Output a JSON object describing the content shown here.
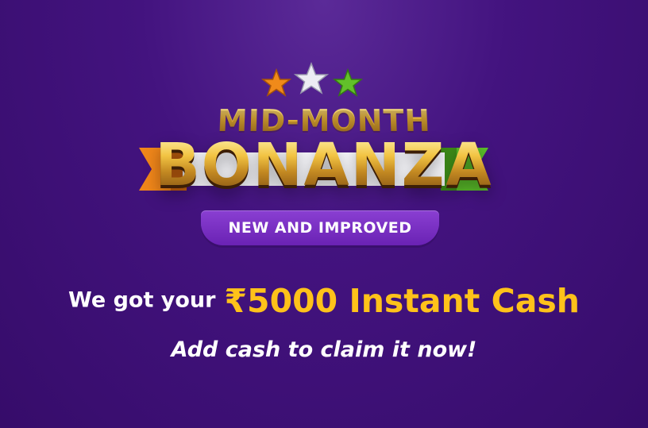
{
  "banner": {
    "title_top": "MID-MONTH",
    "title_main": "BONANZA",
    "tag": "NEW AND IMPROVED",
    "offer_prefix": "We got your",
    "offer_amount": "₹5000 Instant Cash",
    "cta": "Add cash to claim it now!"
  },
  "colors": {
    "background": "#43137f",
    "gold": "#f2c443",
    "offer_yellow": "#ffc21a",
    "pill_purple": "#7a2fc4",
    "star_orange": "#f08a1a",
    "star_silver": "#e6e6ee",
    "star_green": "#62c02a",
    "ribbon_orange": "#f0861a",
    "ribbon_green": "#5bbf2a"
  },
  "icons": {
    "stars": [
      "orange-star-icon",
      "silver-star-icon",
      "green-star-icon"
    ],
    "ribbon": "tricolor-ribbon-icon"
  }
}
